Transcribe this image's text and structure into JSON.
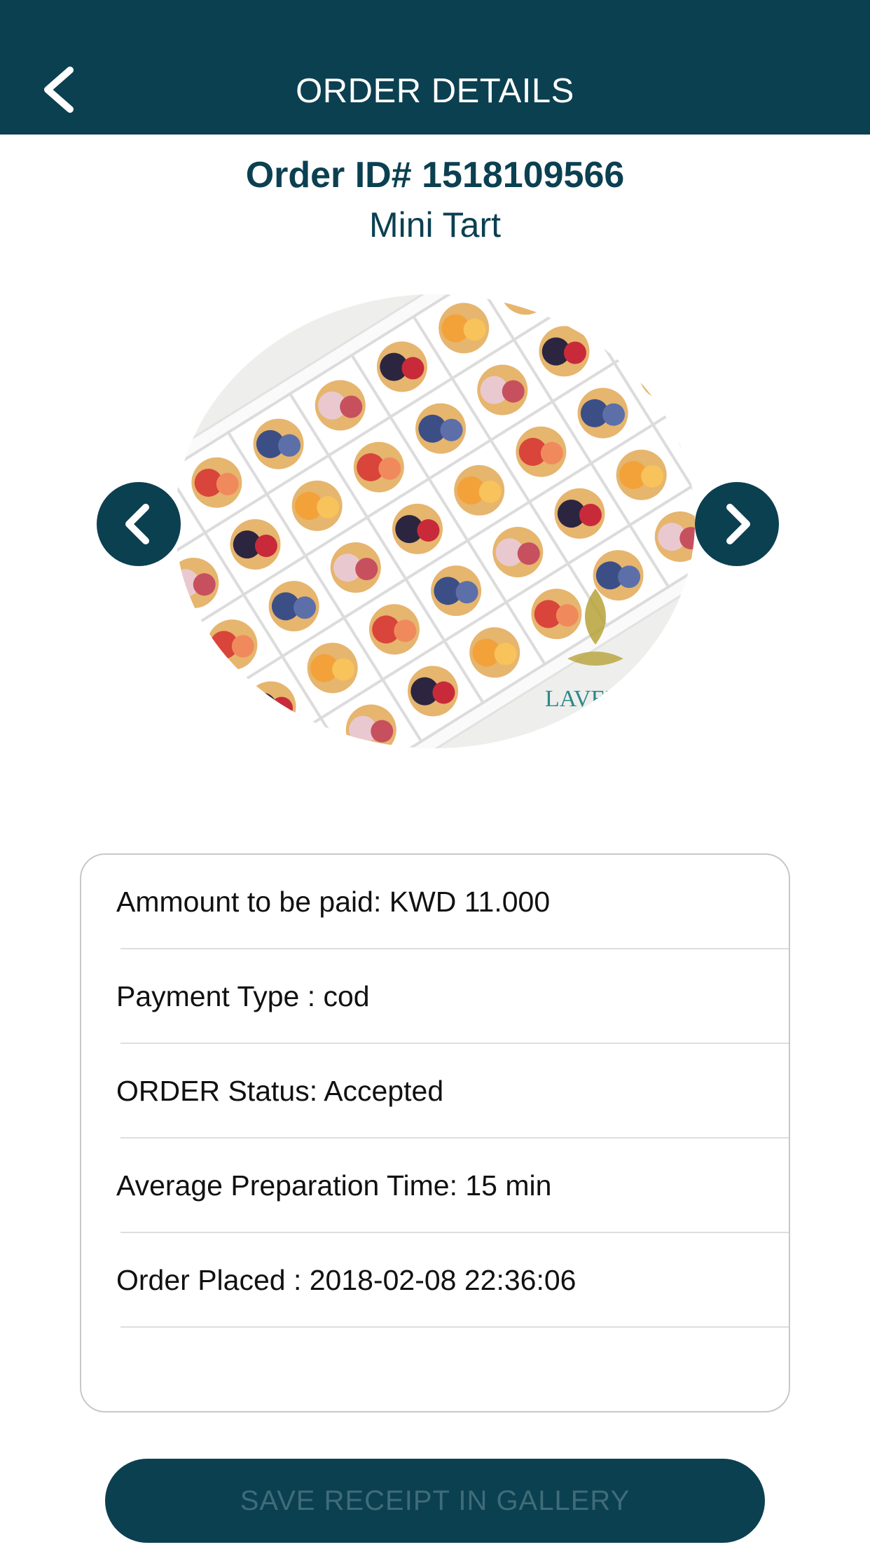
{
  "header": {
    "title": "ORDER DETAILS",
    "back_icon": "chevron-left-icon",
    "background": "#0b4051"
  },
  "order": {
    "id_label": "Order ID# 1518109566",
    "product_name": "Mini Tart",
    "image": "mini-tart-box-photo",
    "image_watermark": "LAVEN"
  },
  "carousel": {
    "prev_icon": "chevron-left-icon",
    "next_icon": "chevron-right-icon"
  },
  "details": [
    {
      "text": "Ammount to be paid: KWD 11.000"
    },
    {
      "text": "Payment Type : cod"
    },
    {
      "text": "ORDER Status: Accepted"
    },
    {
      "text": "Average Preparation Time: 15 min"
    },
    {
      "text": "Order Placed : 2018-02-08 22:36:06"
    }
  ],
  "actions": {
    "save_receipt": "SAVE RECEIPT IN GALLERY"
  },
  "colors": {
    "accent": "#0b4051",
    "button_text": "#3f6c78"
  }
}
